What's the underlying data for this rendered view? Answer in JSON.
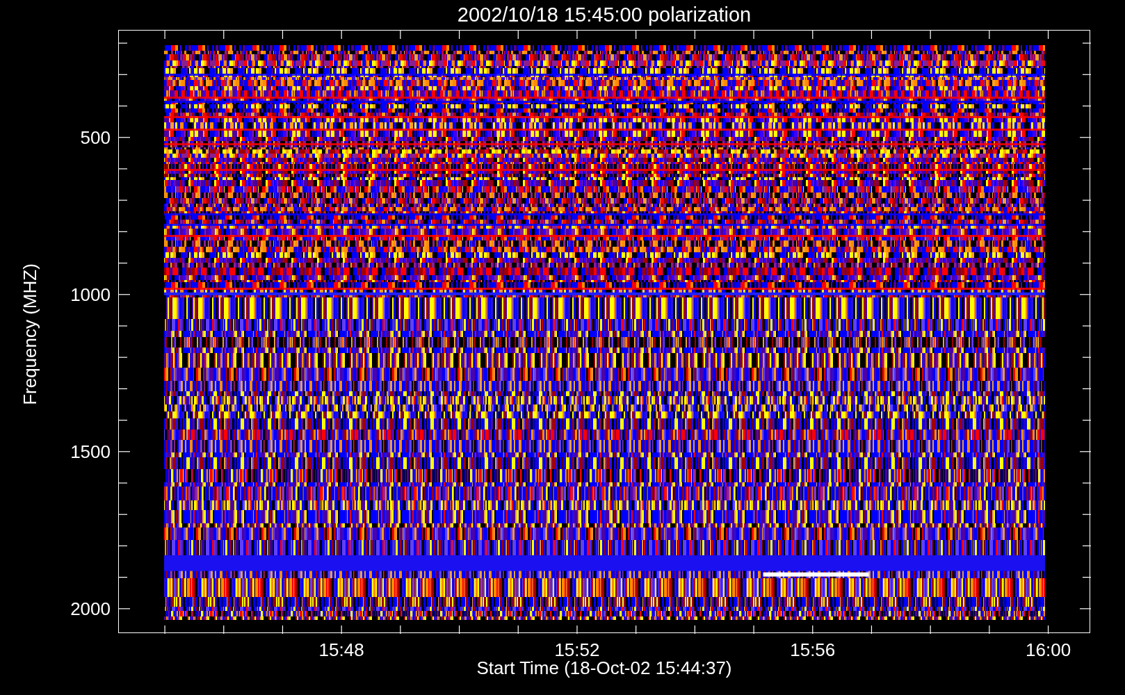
{
  "title": "2002/10/18 15:45:00 polarization",
  "y_axis": {
    "label": "Frequency (MHZ)",
    "ticks": [
      "500",
      "1000",
      "1500",
      "2000"
    ]
  },
  "x_axis": {
    "label": "Start Time (18-Oct-02 15:44:37)",
    "ticks": [
      "15:48",
      "15:52",
      "15:56",
      "16:00"
    ]
  }
}
